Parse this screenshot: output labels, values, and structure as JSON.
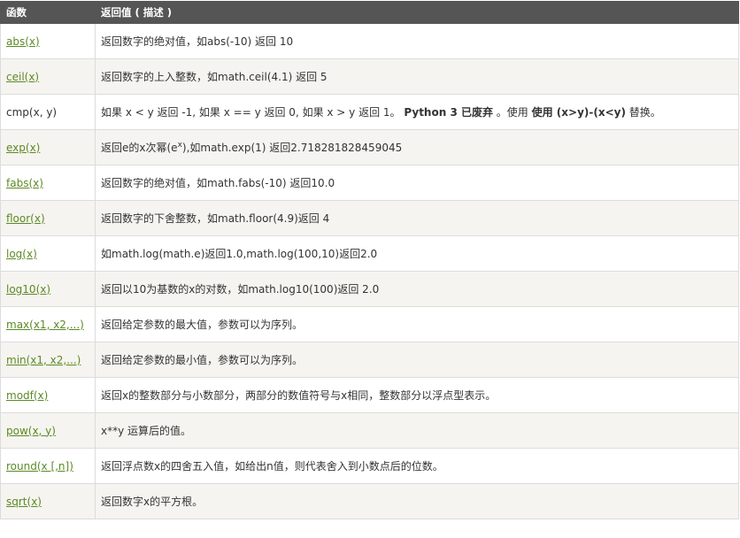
{
  "header": {
    "col1": "函数",
    "col2": "返回值 ( 描述 )"
  },
  "link_color": "#5c8a25",
  "header_bg": "#555555",
  "rows": [
    {
      "fn": "abs(x)",
      "link": true,
      "desc": "返回数字的绝对值，如abs(-10) 返回 10"
    },
    {
      "fn": "ceil(x)",
      "link": true,
      "desc": "返回数字的上入整数，如math.ceil(4.1) 返回 5"
    },
    {
      "fn": "cmp(x, y)",
      "link": false,
      "desc_a": "如果 x < y 返回 -1, 如果 x == y 返回 0, 如果 x > y 返回 1。 ",
      "desc_b": "Python 3 已废弃",
      "desc_c": " 。使用 ",
      "desc_d": "使用 (x>y)-(x<y)",
      "desc_e": " 替换。"
    },
    {
      "fn": "exp(x)",
      "link": true,
      "desc_a": "返回e的x次幂(e",
      "desc_sup": "x",
      "desc_b": "),如math.exp(1) 返回2.718281828459045"
    },
    {
      "fn": "fabs(x)",
      "link": true,
      "desc": "返回数字的绝对值，如math.fabs(-10) 返回10.0"
    },
    {
      "fn": "floor(x)",
      "link": true,
      "desc": "返回数字的下舍整数，如math.floor(4.9)返回 4"
    },
    {
      "fn": "log(x)",
      "link": true,
      "desc": "如math.log(math.e)返回1.0,math.log(100,10)返回2.0"
    },
    {
      "fn": "log10(x)",
      "link": true,
      "desc": "返回以10为基数的x的对数，如math.log10(100)返回 2.0"
    },
    {
      "fn": "max(x1, x2,...)",
      "link": true,
      "desc": "返回给定参数的最大值，参数可以为序列。"
    },
    {
      "fn": "min(x1, x2,...)",
      "link": true,
      "desc": "返回给定参数的最小值，参数可以为序列。"
    },
    {
      "fn": "modf(x)",
      "link": true,
      "desc": "返回x的整数部分与小数部分，两部分的数值符号与x相同，整数部分以浮点型表示。"
    },
    {
      "fn": "pow(x, y)",
      "link": true,
      "desc": "x**y 运算后的值。"
    },
    {
      "fn": "round(x [,n])",
      "link": true,
      "desc": "返回浮点数x的四舍五入值，如给出n值，则代表舍入到小数点后的位数。"
    },
    {
      "fn": "sqrt(x)",
      "link": true,
      "desc": "返回数字x的平方根。"
    }
  ]
}
